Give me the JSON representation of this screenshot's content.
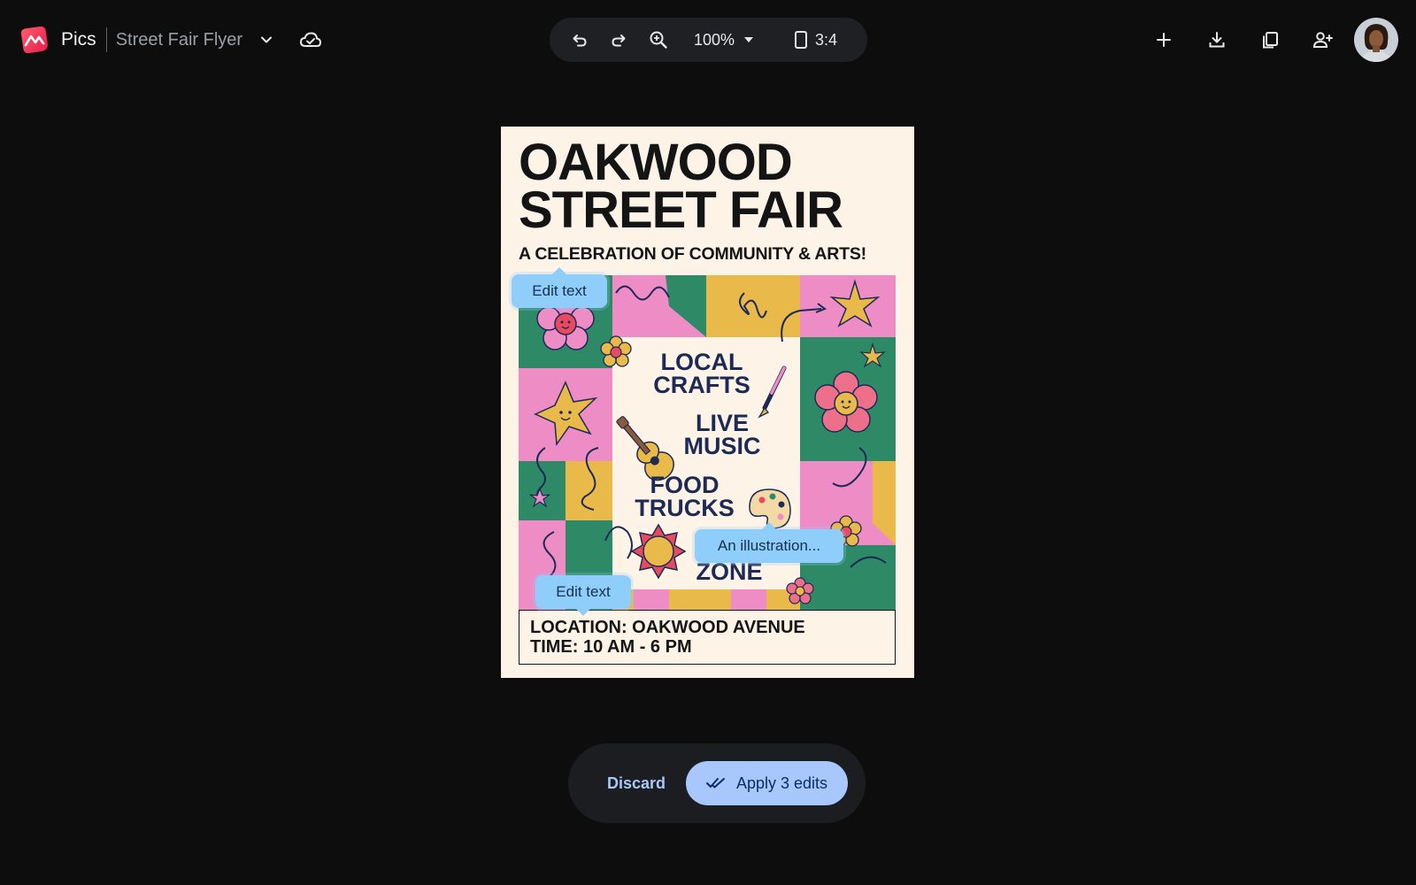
{
  "app": {
    "name": "Pics",
    "doc_title": "Street Fair Flyer"
  },
  "toolbar": {
    "zoom_level": "100%",
    "aspect_ratio": "3:4",
    "icons": [
      "undo-icon",
      "redo-icon",
      "zoom-in-icon",
      "aspect-ratio-icon"
    ]
  },
  "header_actions": [
    "add-icon",
    "download-icon",
    "copy-icon",
    "add-person-icon",
    "avatar"
  ],
  "flyer": {
    "title_line1": "OAKWOOD",
    "title_line2": "STREET FAIR",
    "subtitle": "A CELEBRATION OF COMMUNITY & ARTS!",
    "labels": {
      "crafts_1": "LOCAL",
      "crafts_2": "CRAFTS",
      "music_1": "LIVE",
      "music_2": "MUSIC",
      "food_1": "FOOD",
      "food_2": "TRUCKS",
      "zone": "ZONE"
    },
    "location": "LOCATION: OAKWOOD AVENUE",
    "time": "TIME: 10 AM - 6 PM"
  },
  "edit_chips": {
    "chip_1": "Edit text",
    "chip_2": "An illustration...",
    "chip_3": "Edit text"
  },
  "actions": {
    "discard": "Discard",
    "apply": "Apply 3 edits"
  },
  "colors": {
    "background": "#0d0d0d",
    "toolbar_bg": "#1f2023",
    "chip_bg": "#8fcdfb",
    "apply_bg": "#a8c7fa",
    "flyer_bg": "#fdf3e6",
    "pink": "#ee8cc6",
    "green": "#2e8a66",
    "yellow": "#e9b949",
    "navy": "#1c2a55"
  }
}
